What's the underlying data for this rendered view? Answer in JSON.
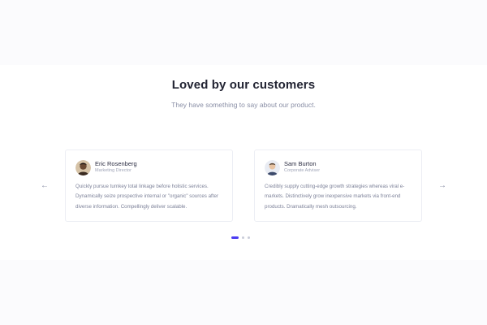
{
  "section": {
    "title": "Loved by our customers",
    "subtitle": "They have something to say about our product."
  },
  "carousel": {
    "prev_icon": "arrow-left-icon",
    "next_icon": "arrow-right-icon",
    "prev_glyph": "←",
    "next_glyph": "→",
    "active_dot_color": "#4b3cf2",
    "dots_count": 3,
    "active_index": 0
  },
  "testimonials": [
    {
      "name": "Eric Rosenberg",
      "role": "Marketing Director",
      "quote": "Quickly pursue turnkey total linkage before holistic services. Dynamically seize prospective internal or \"organic\" sources after diverse information. Compellingly deliver scalable."
    },
    {
      "name": "Sam Burton",
      "role": "Corporate Adviser",
      "quote": "Credibly supply cutting-edge growth strategies whereas viral e-markets. Distinctively grow inexpensive markets via front-end products. Dramatically mesh outsourcing."
    }
  ]
}
